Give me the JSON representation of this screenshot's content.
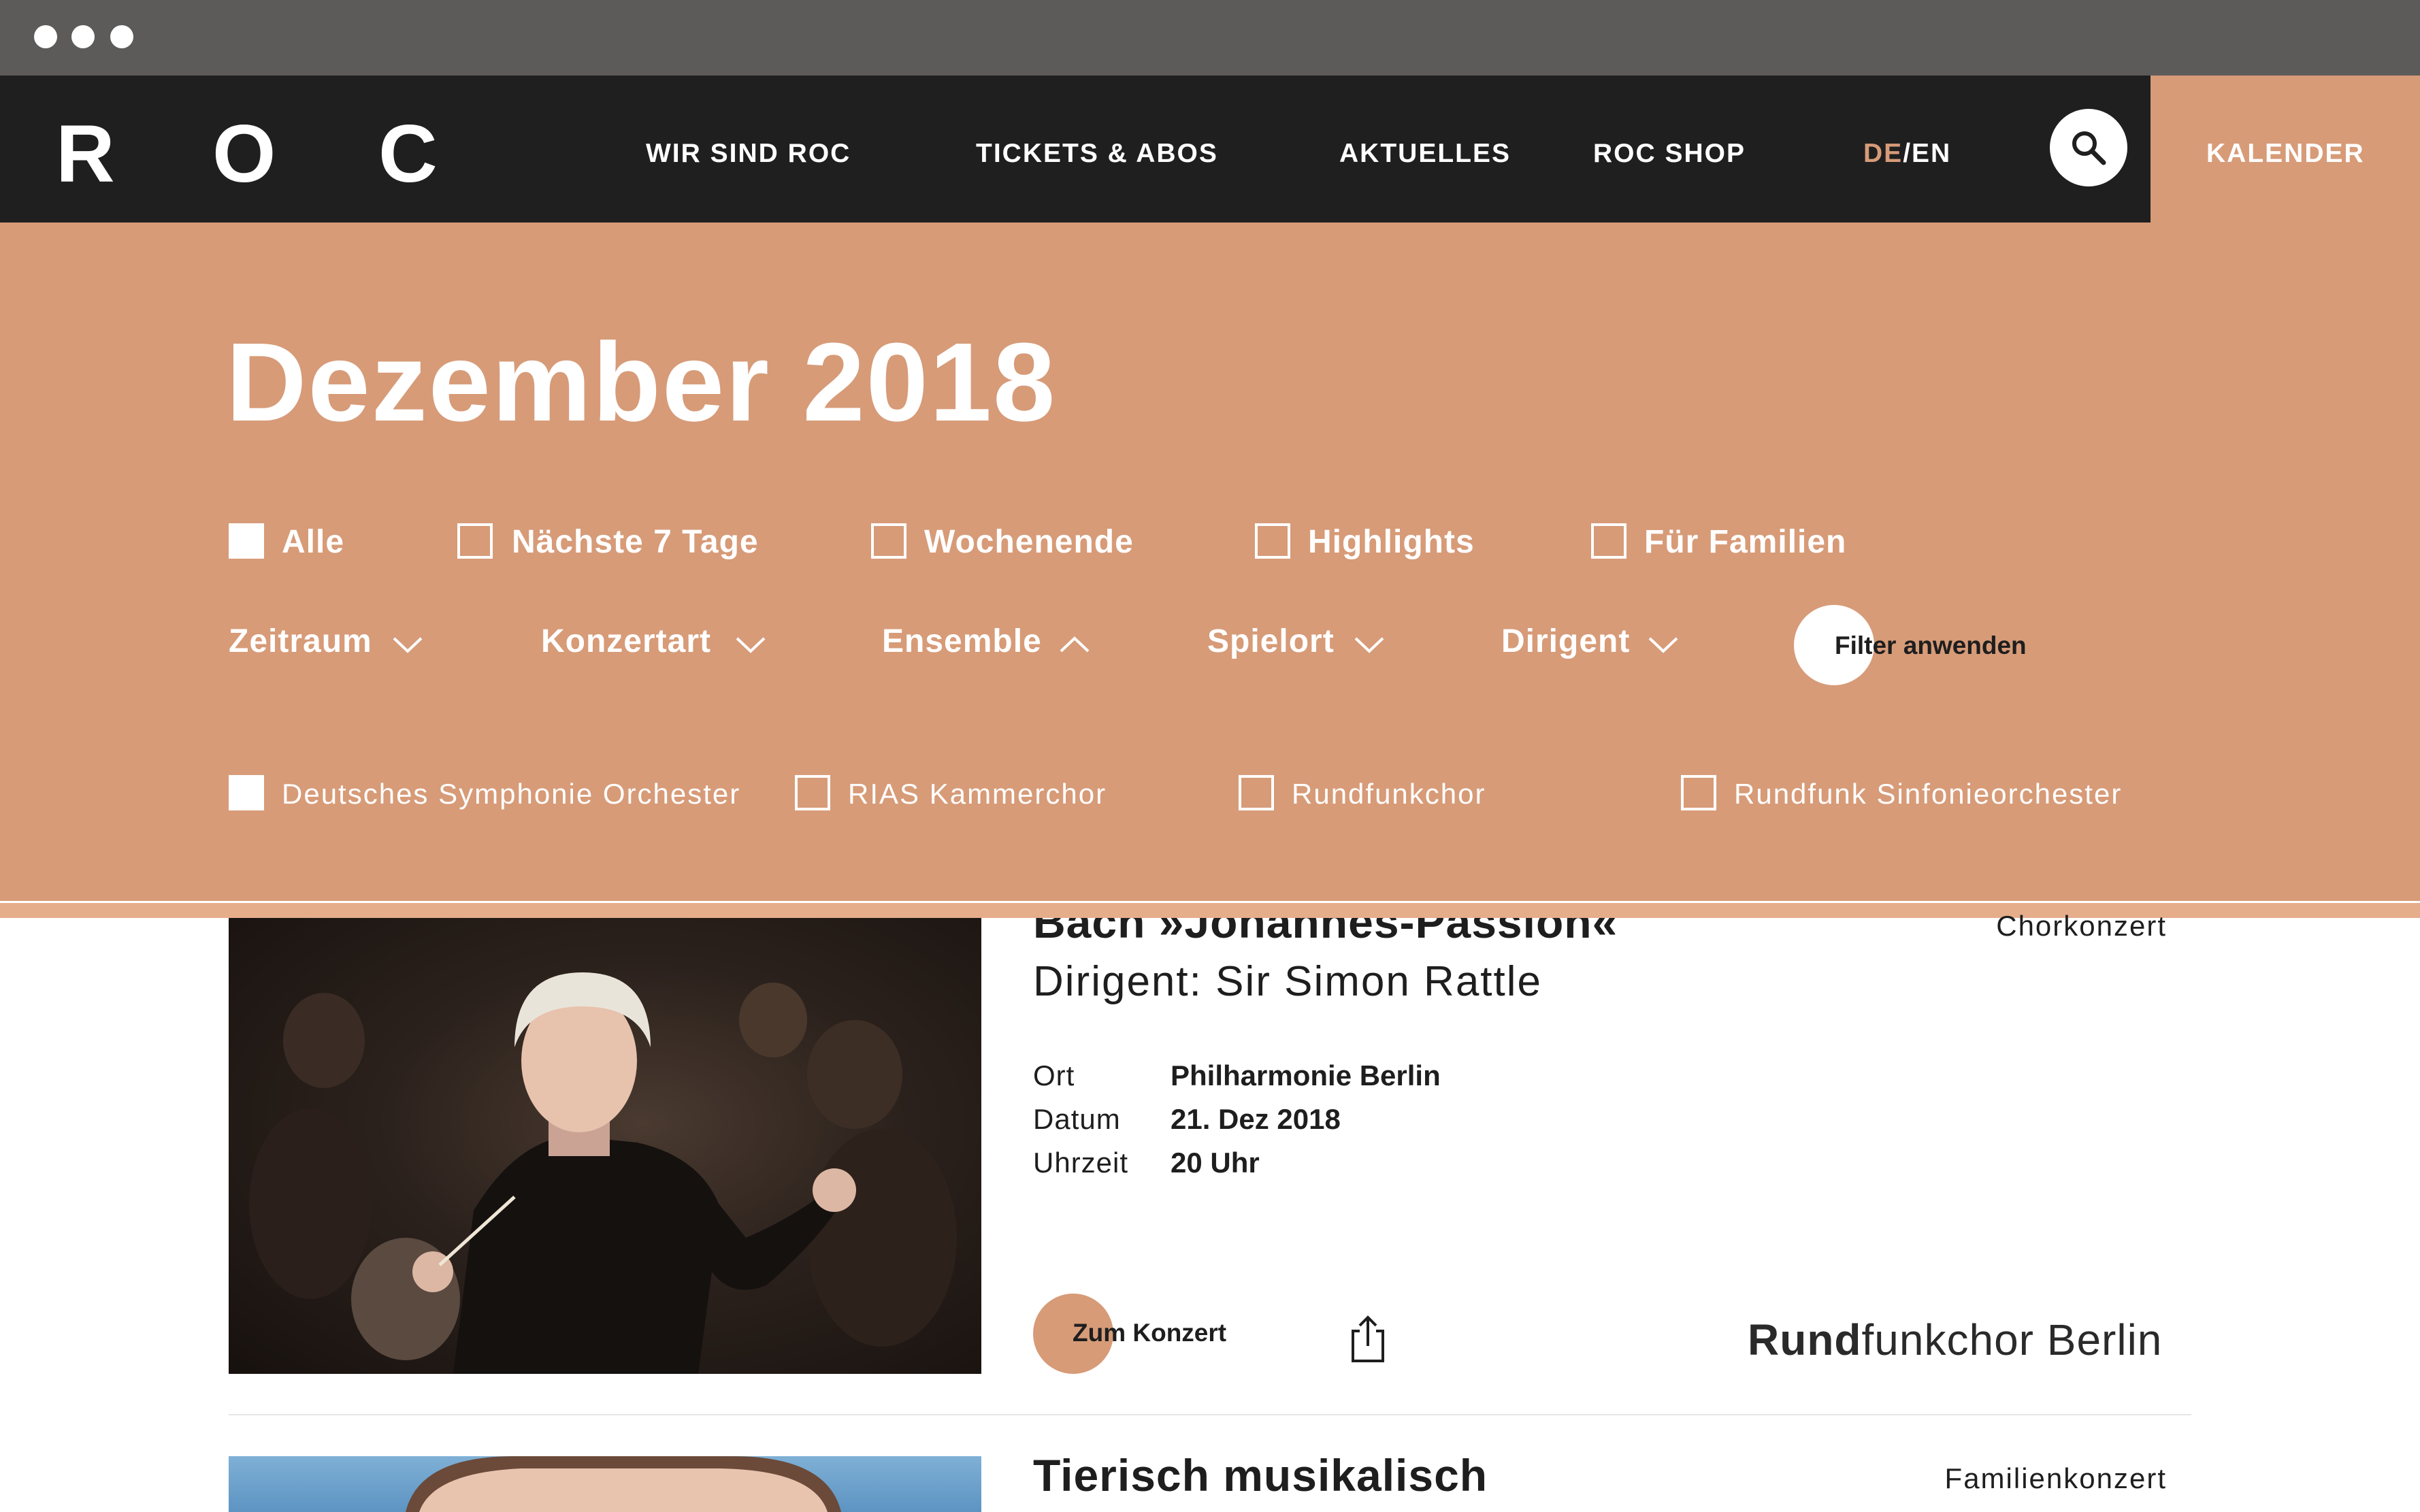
{
  "header": {
    "logo_letters": [
      "R",
      "O",
      "C"
    ],
    "nav": [
      "WIR SIND ROC",
      "TICKETS & ABOS",
      "AKTUELLES",
      "ROC SHOP"
    ],
    "lang_active": "DE",
    "lang_sep": "/",
    "lang_other": "EN",
    "kalender": "KALENDER"
  },
  "calendar": {
    "title": "Dezember 2018",
    "quick_filters": [
      {
        "label": "Alle",
        "checked": true
      },
      {
        "label": "Nächste 7 Tage",
        "checked": false
      },
      {
        "label": "Wochenende",
        "checked": false
      },
      {
        "label": "Highlights",
        "checked": false
      },
      {
        "label": "Für Familien",
        "checked": false
      }
    ],
    "dropdowns": [
      {
        "label": "Zeitraum",
        "open": false
      },
      {
        "label": "Konzertart",
        "open": false
      },
      {
        "label": "Ensemble",
        "open": true
      },
      {
        "label": "Spielort",
        "open": false
      },
      {
        "label": "Dirigent",
        "open": false
      }
    ],
    "apply_button": "Filter anwenden",
    "ensemble_options": [
      {
        "label": "Deutsches Symphonie Orchester",
        "checked": true
      },
      {
        "label": "RIAS Kammerchor",
        "checked": false
      },
      {
        "label": "Rundfunkchor",
        "checked": false
      },
      {
        "label": "Rundfunk Sinfonieorchester",
        "checked": false
      }
    ]
  },
  "concerts": [
    {
      "title": "Bach »Johannes-Passion«",
      "subtitle": "Dirigent: Sir Simon Rattle",
      "type": "Chorkonzert",
      "meta": [
        {
          "key": "Ort",
          "value": "Philharmonie Berlin"
        },
        {
          "key": "Datum",
          "value": "21. Dez 2018"
        },
        {
          "key": "Uhrzeit",
          "value": "20 Uhr"
        }
      ],
      "cta": "Zum Konzert",
      "ensemble_brand_bold": "Rund",
      "ensemble_brand_rest": "funkchor Berlin"
    },
    {
      "title": "Tierisch musikalisch",
      "type": "Familienkonzert"
    }
  ],
  "colors": {
    "accent": "#d79b78",
    "dark": "#1f1f1f",
    "chrome": "#5c5b5a"
  }
}
